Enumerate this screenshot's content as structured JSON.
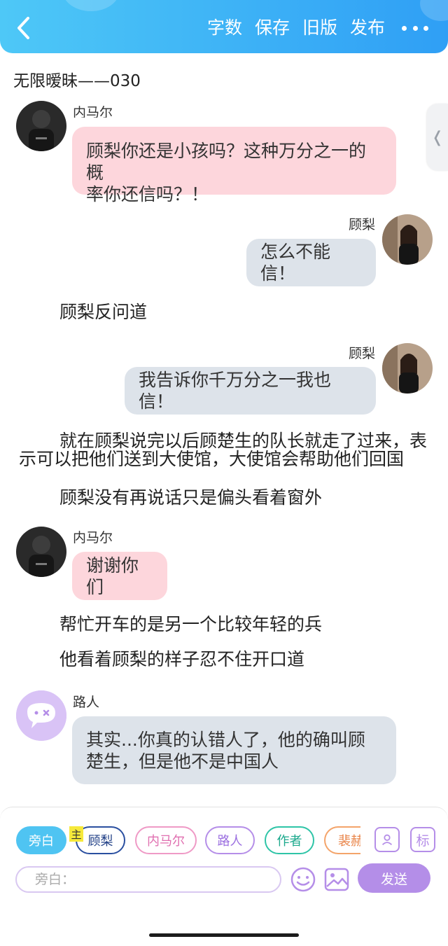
{
  "header": {
    "actions": [
      "字数",
      "保存",
      "旧版",
      "发布"
    ]
  },
  "story": {
    "title": "无限暧昧——030"
  },
  "characters": {
    "nema": "内马尔",
    "guli": "顾梨",
    "passerby": "路人"
  },
  "messages": {
    "m1_name": "内马尔",
    "m1_line1": "顾梨你还是小孩吗？这种万分之一的概",
    "m1_line2": "率你还信吗？！",
    "m2_name": "顾梨",
    "m2_text": "怎么不能信！",
    "n1": "顾梨反问道",
    "m3_name": "顾梨",
    "m3_text": "我告诉你千万分之一我也信！",
    "n2_line1": "就在顾梨说完以后顾楚生的队长就走了过来，表",
    "n2_line2": "示可以把他们送到大使馆，大使馆会帮助他们回国",
    "n3": "顾梨没有再说话只是偏头看着窗外",
    "m4_name": "内马尔",
    "m4_text": "谢谢你们",
    "n4": "帮忙开车的是另一个比较年轻的兵",
    "n5": "他看着顾梨的样子忍不住开口道",
    "m5_name": "路人",
    "m5_line1": "其实...你真的认错人了，他的确叫顾",
    "m5_line2": "楚生，但是他不是中国人"
  },
  "roles": {
    "chips": [
      "旁白",
      "顾梨",
      "内马尔",
      "路人",
      "作者",
      "裴赫"
    ],
    "main_tag": "主",
    "biao_label": "标"
  },
  "composer": {
    "placeholder": "旁白：",
    "send_label": "发送"
  },
  "colors": {
    "header": "#2f9ff5",
    "pink_bubble": "#fdd6dc",
    "gray_bubble": "#dde3ea",
    "send": "#b48ee8"
  }
}
